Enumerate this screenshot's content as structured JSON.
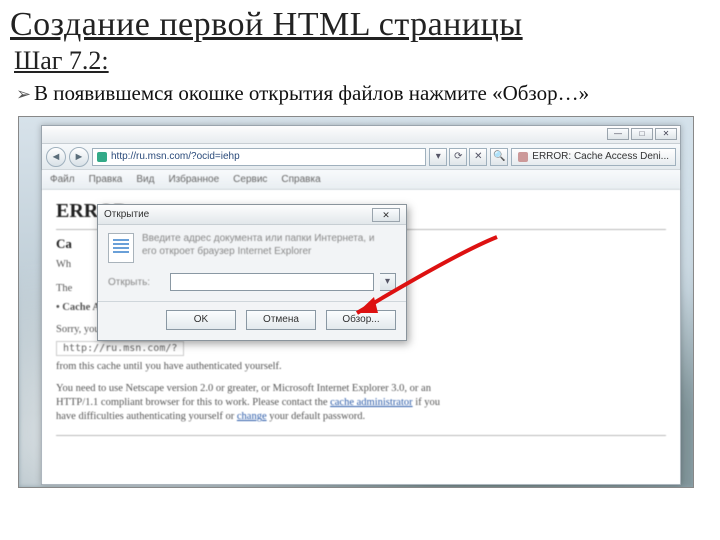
{
  "slide": {
    "title": "Создание первой HTML страницы",
    "step_label": "Шаг 7.2:",
    "body": "В появившемся окошке открытия файлов нажмите «Обзор…»"
  },
  "browser": {
    "url": "http://ru.msn.com/?ocid=iehp",
    "tab_title": "ERROR: Cache Access Deni...",
    "menus": [
      "Файл",
      "Правка",
      "Вид",
      "Избранное",
      "Сервис",
      "Справка"
    ],
    "win_buttons": {
      "min": "—",
      "max": "□",
      "close": "✕"
    },
    "nav": {
      "back": "◄",
      "fwd": "►",
      "dd": "▾",
      "refresh": "⟳",
      "stop": "✕",
      "search": "🔍"
    }
  },
  "page": {
    "h_error": "ERROR",
    "h_sub": "Ca",
    "bullet": "• Cache Access Denied.",
    "line_wh": "Wh",
    "line_the": "The",
    "link_tail": "m/?",
    "sorry": "Sorry, you are not currently allowed to request:",
    "url_shown": "http://ru.msn.com/?",
    "cache_line": "from this cache until you have authenticated yourself.",
    "para_a": "You need to use Netscape version 2.0 or greater, or Microsoft Internet Explorer 3.0, or an",
    "para_b": "HTTP/1.1 compliant browser for this to work. Please contact the ",
    "para_b_link": "cache administrator",
    "para_b_tail": " if you",
    "para_c": "have difficulties authenticating yourself or ",
    "para_c_link": "change",
    "para_c_tail": " your default password."
  },
  "dialog": {
    "title": "Открытие",
    "desc1": "Введите адрес документа или папки Интернета, и",
    "desc2": "его откроет браузер Internet Explorer",
    "open_label": "Открыть:",
    "btn_ok": "OK",
    "btn_cancel": "Отмена",
    "btn_browse": "Обзор...",
    "close_glyph": "✕",
    "dd": "▾"
  }
}
